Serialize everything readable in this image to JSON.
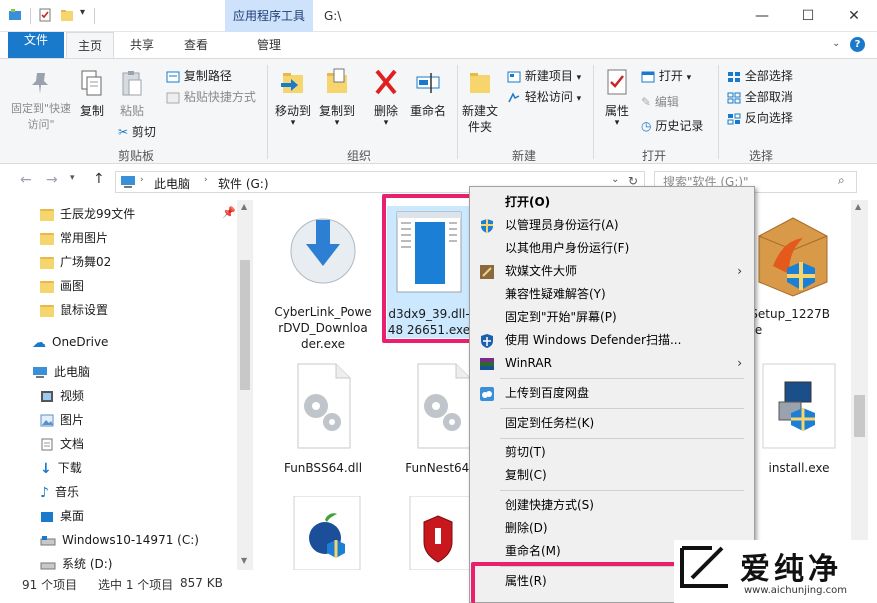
{
  "titlebar": {
    "context_tab": "应用程序工具",
    "path_title": "G:\\",
    "minimize": "—",
    "maximize": "☐",
    "close": "✕"
  },
  "tabs": {
    "file": "文件",
    "home": "主页",
    "share": "共享",
    "view": "查看",
    "manage": "管理"
  },
  "ribbon": {
    "pin_quick_access": "固定到\"快速访问\"",
    "copy": "复制",
    "paste": "粘贴",
    "copy_path": "复制路径",
    "paste_shortcut": "粘贴快捷方式",
    "cut": "剪切",
    "group_clipboard": "剪贴板",
    "move_to": "移动到",
    "copy_to": "复制到",
    "delete": "删除",
    "rename": "重命名",
    "group_organize": "组织",
    "new_folder": "新建文件夹",
    "new_item": "新建项目",
    "easy_access": "轻松访问",
    "group_new": "新建",
    "properties": "属性",
    "open": "打开",
    "edit": "编辑",
    "history": "历史记录",
    "group_open": "打开",
    "select_all": "全部选择",
    "select_none": "全部取消",
    "invert_selection": "反向选择",
    "group_select": "选择"
  },
  "address": {
    "crumb_pc": "此电脑",
    "crumb_drive": "软件 (G:)",
    "search_placeholder": "搜索\"软件 (G:)\""
  },
  "nav": {
    "items": [
      {
        "label": "壬辰龙99文件"
      },
      {
        "label": "常用图片"
      },
      {
        "label": "广场舞02"
      },
      {
        "label": "画图"
      },
      {
        "label": "鼠标设置"
      },
      {
        "label": "OneDrive"
      },
      {
        "label": "此电脑"
      },
      {
        "label": "视频"
      },
      {
        "label": "图片"
      },
      {
        "label": "文档"
      },
      {
        "label": "下载"
      },
      {
        "label": "音乐"
      },
      {
        "label": "桌面"
      },
      {
        "label": "Windows10-14971 (C:)"
      },
      {
        "label": "系统 (D:)"
      }
    ]
  },
  "files": [
    {
      "name": "CyberLink_PowerDVD_Downloader.exe"
    },
    {
      "name": "d3dx9_39.dll-48 26651.exe"
    },
    {
      "name": "GSetup_1227Bexe"
    },
    {
      "name": "FunBSS64.dll"
    },
    {
      "name": "FunNest64.dll"
    },
    {
      "name": "install.exe"
    }
  ],
  "file_lines": {
    "f0": [
      "CyberLink_Powe",
      "rDVD_Downloa",
      "der.exe"
    ],
    "f1": [
      "d3dx9_39.dll-",
      "48 26651.exe"
    ],
    "f2": [
      "GSetup_1227B",
      "exe"
    ],
    "f3": [
      "FunBSS64.dll"
    ],
    "f4": [
      "FunNest64.d"
    ],
    "f5": [
      "install.exe"
    ]
  },
  "status": {
    "count": "91 个项目",
    "selected": "选中 1 个项目",
    "size": "857 KB"
  },
  "context_menu": {
    "open": "打开(O)",
    "run_as_admin": "以管理员身份运行(A)",
    "run_as_other": "以其他用户身份运行(F)",
    "software_master": "软媒文件大师",
    "compat_troubleshoot": "兼容性疑难解答(Y)",
    "pin_start": "固定到\"开始\"屏幕(P)",
    "defender_scan": "使用 Windows Defender扫描...",
    "winrar": "WinRAR",
    "upload_baidu": "上传到百度网盘",
    "pin_taskbar": "固定到任务栏(K)",
    "cut": "剪切(T)",
    "copy": "复制(C)",
    "create_shortcut": "创建快捷方式(S)",
    "delete": "删除(D)",
    "rename": "重命名(M)",
    "properties": "属性(R)"
  },
  "watermark": {
    "brand": "爱纯净",
    "url": "www.aichunjing.com"
  },
  "colors": {
    "accent": "#1979ca",
    "highlight": "#e8206d",
    "context_tab": "#cfe2fb"
  }
}
